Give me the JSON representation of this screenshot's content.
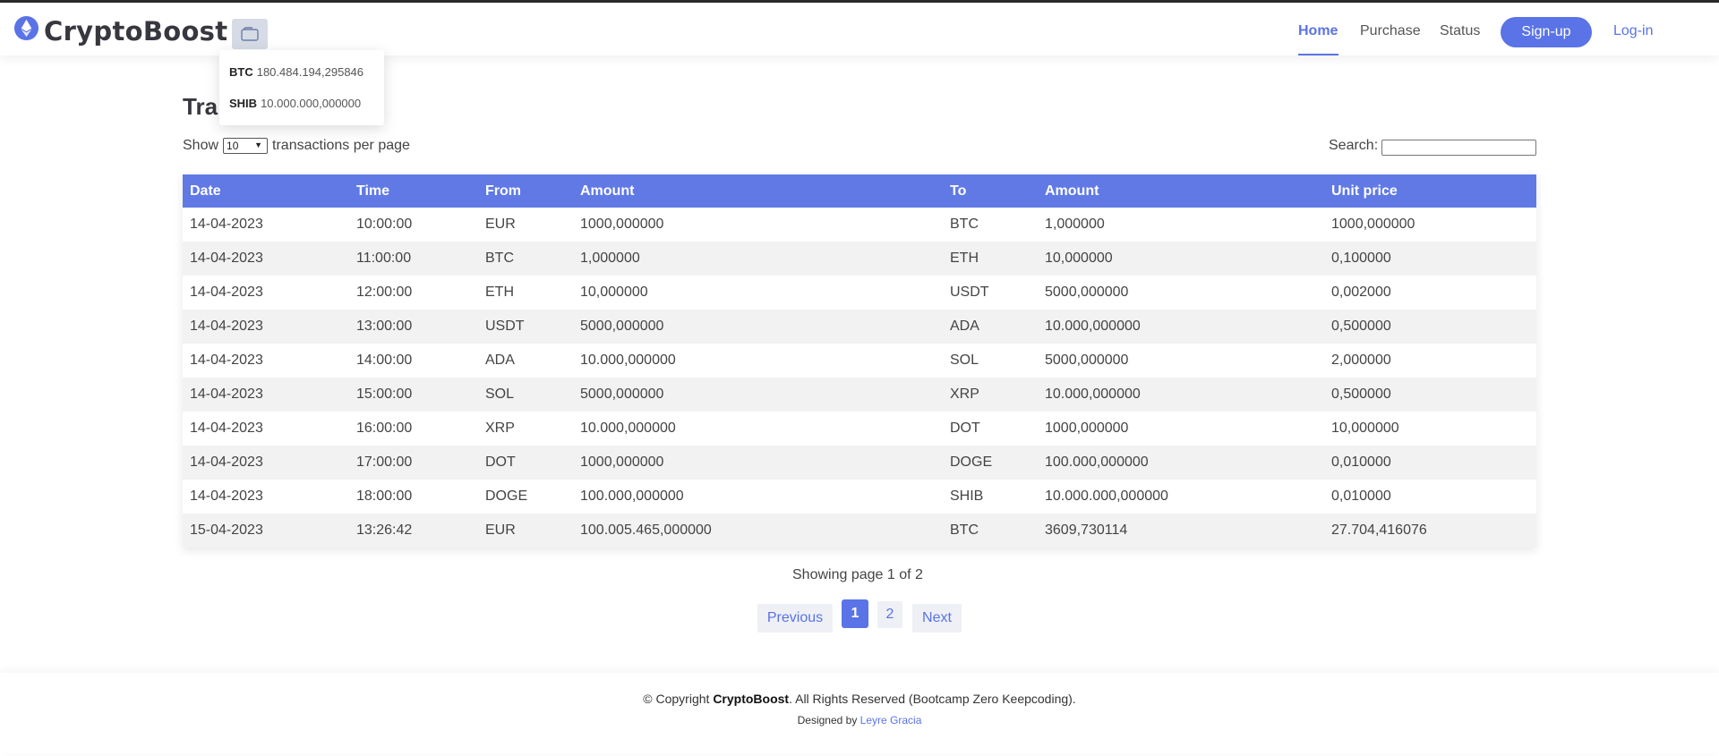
{
  "header": {
    "brand": "CryptoBoost",
    "nav": {
      "home": "Home",
      "purchase": "Purchase",
      "status": "Status",
      "signup": "Sign-up",
      "login": "Log-in"
    }
  },
  "wallet": {
    "items": [
      {
        "coin": "BTC",
        "amount": "180.484.194,295846"
      },
      {
        "coin": "SHIB",
        "amount": "10.000.000,000000"
      }
    ]
  },
  "main": {
    "title": "Tra",
    "show_label": "Show",
    "per_page_value": "10",
    "per_page_suffix": "transactions per page",
    "search_label": "Search:",
    "search_value": ""
  },
  "table": {
    "headers": [
      "Date",
      "Time",
      "From",
      "Amount",
      "To",
      "Amount",
      "Unit price"
    ],
    "rows": [
      [
        "14-04-2023",
        "10:00:00",
        "EUR",
        "1000,000000",
        "BTC",
        "1,000000",
        "1000,000000"
      ],
      [
        "14-04-2023",
        "11:00:00",
        "BTC",
        "1,000000",
        "ETH",
        "10,000000",
        "0,100000"
      ],
      [
        "14-04-2023",
        "12:00:00",
        "ETH",
        "10,000000",
        "USDT",
        "5000,000000",
        "0,002000"
      ],
      [
        "14-04-2023",
        "13:00:00",
        "USDT",
        "5000,000000",
        "ADA",
        "10.000,000000",
        "0,500000"
      ],
      [
        "14-04-2023",
        "14:00:00",
        "ADA",
        "10.000,000000",
        "SOL",
        "5000,000000",
        "2,000000"
      ],
      [
        "14-04-2023",
        "15:00:00",
        "SOL",
        "5000,000000",
        "XRP",
        "10.000,000000",
        "0,500000"
      ],
      [
        "14-04-2023",
        "16:00:00",
        "XRP",
        "10.000,000000",
        "DOT",
        "1000,000000",
        "10,000000"
      ],
      [
        "14-04-2023",
        "17:00:00",
        "DOT",
        "1000,000000",
        "DOGE",
        "100.000,000000",
        "0,010000"
      ],
      [
        "14-04-2023",
        "18:00:00",
        "DOGE",
        "100.000,000000",
        "SHIB",
        "10.000.000,000000",
        "0,010000"
      ],
      [
        "15-04-2023",
        "13:26:42",
        "EUR",
        "100.005.465,000000",
        "BTC",
        "3609,730114",
        "27.704,416076"
      ]
    ]
  },
  "pagination": {
    "info": "Showing page 1 of 2",
    "previous": "Previous",
    "pages": [
      "1",
      "2"
    ],
    "current": "1",
    "next": "Next"
  },
  "footer": {
    "copyright_prefix": "© Copyright",
    "copyright_brand": "CryptoBoost",
    "copyright_suffix": ". All Rights Reserved (Bootcamp Zero Keepcoding).",
    "designed_prefix": "Designed by",
    "designer": "Leyre Gracia"
  },
  "colors": {
    "accent": "#5a73e6",
    "table_header": "#6079e5",
    "row_stripe": "#f2f2f2"
  }
}
